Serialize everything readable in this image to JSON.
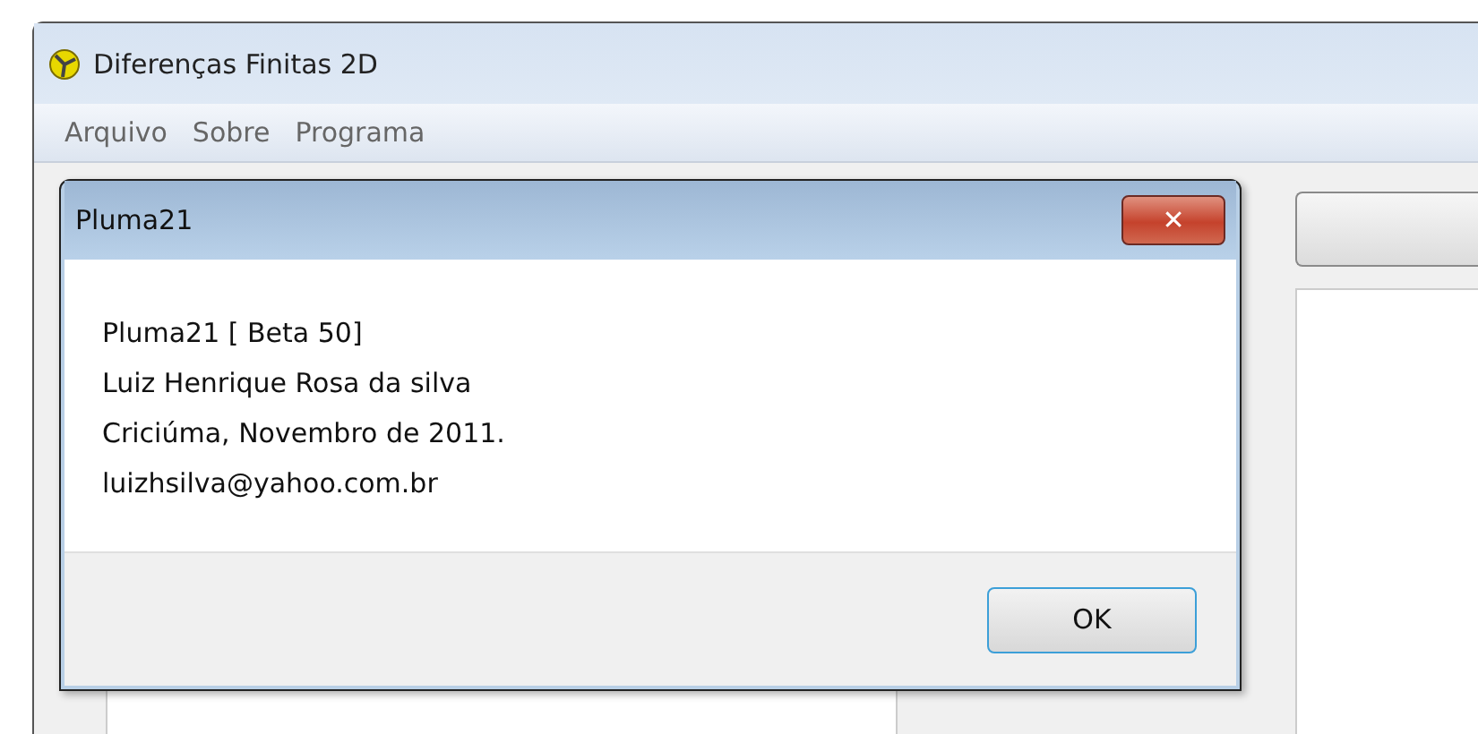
{
  "window": {
    "title": "Diferenças Finitas 2D"
  },
  "menu": [
    "Arquivo",
    "Sobre",
    "Programa"
  ],
  "dialog": {
    "title": "Pluma21",
    "lines": [
      "Pluma21 [ Beta 50]",
      "Luiz Henrique Rosa da silva",
      "Criciúma, Novembro de 2011.",
      "luizhsilva@yahoo.com.br"
    ],
    "close_icon": "✕",
    "button": "OK"
  }
}
